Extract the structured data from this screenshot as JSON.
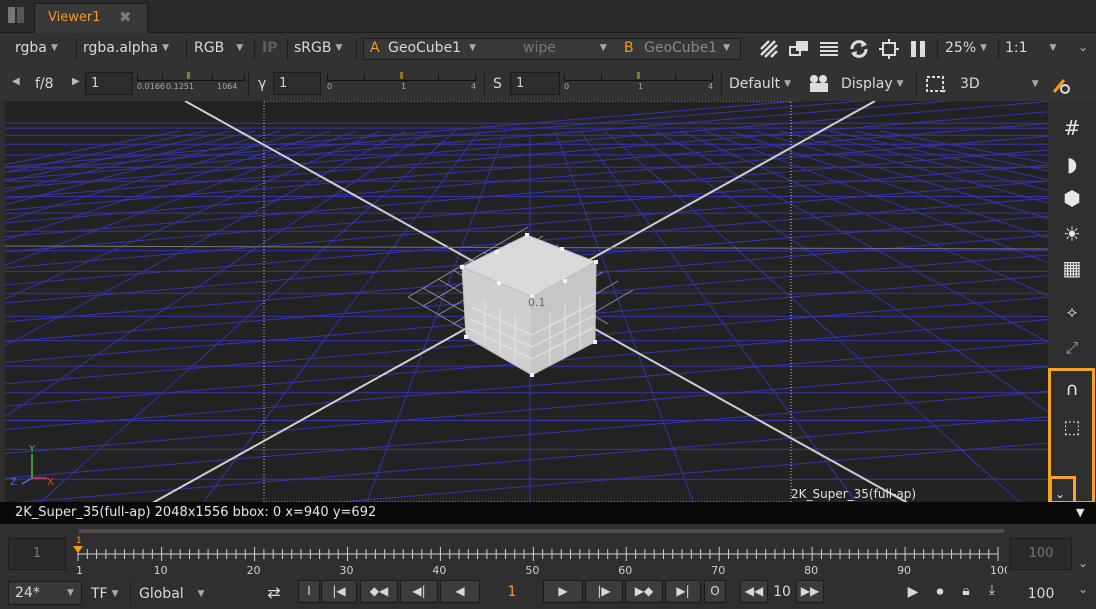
{
  "tab": {
    "title": "Viewer1",
    "close": "✖"
  },
  "toolbar1": {
    "channels": "rgba",
    "alpha_channel": "rgba.alpha",
    "display_channels": "RGB",
    "ip_label": "IP",
    "colorspace": "sRGB",
    "input_a_letter": "A",
    "input_a": "GeoCube1",
    "wipe": "wipe",
    "input_b_letter": "B",
    "input_b": "GeoCube1",
    "zoom": "25%",
    "ratio": "1:1"
  },
  "toolbar2": {
    "fstop": "f/8",
    "gain_value": "1",
    "gain_ticks": [
      "0.0166",
      "0.125",
      "1",
      "1064"
    ],
    "gamma_label": "γ",
    "gamma_value": "1",
    "gamma_ticks": [
      "0",
      "1",
      "4"
    ],
    "sat_label": "S",
    "sat_value": "1",
    "sat_ticks": [
      "0",
      "1",
      "4"
    ],
    "lut": "Default",
    "display": "Display",
    "view_mode": "3D"
  },
  "viewport": {
    "format_label": "2K_Super_35(full-ap)",
    "cube_label": "0.1",
    "axis_y": "Y",
    "axis_z": "Z",
    "axis_x": "X"
  },
  "infobar": {
    "text": "2K_Super_35(full-ap) 2048x1556  bbox: 0  x=940 y=692"
  },
  "timeline": {
    "in_frame": "1",
    "out_frame": "100",
    "current_marker": "1",
    "ticks": [
      "1",
      "10",
      "20",
      "30",
      "40",
      "50",
      "60",
      "70",
      "80",
      "90",
      "100"
    ]
  },
  "controls": {
    "fps": "24*",
    "tf": "TF",
    "global": "Global",
    "in_point": "I",
    "out_point": "O",
    "current_frame": "1",
    "step": "10",
    "end_frame": "100"
  },
  "colors": {
    "accent": "#f39a1f",
    "grid": "#3a3ab8",
    "highlight": "#f3a523"
  }
}
